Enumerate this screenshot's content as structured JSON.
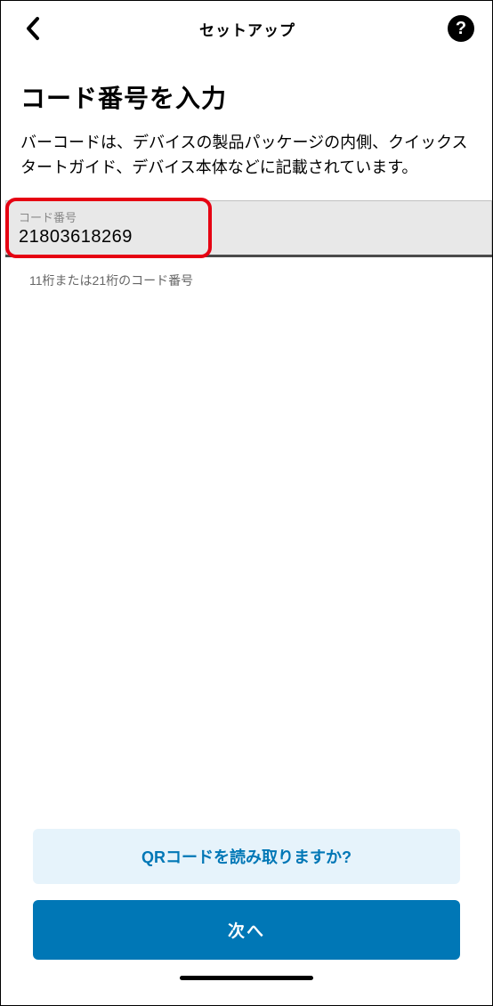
{
  "header": {
    "title": "セットアップ"
  },
  "page": {
    "title": "コード番号を入力",
    "description": "バーコードは、デバイスの製品パッケージの内側、クイックスタートガイド、デバイス本体などに記載されています。"
  },
  "input": {
    "label": "コード番号",
    "value": "21803618269",
    "helper": "11桁または21桁のコード番号"
  },
  "buttons": {
    "secondary": "QRコードを読み取りますか?",
    "primary": "次へ"
  }
}
